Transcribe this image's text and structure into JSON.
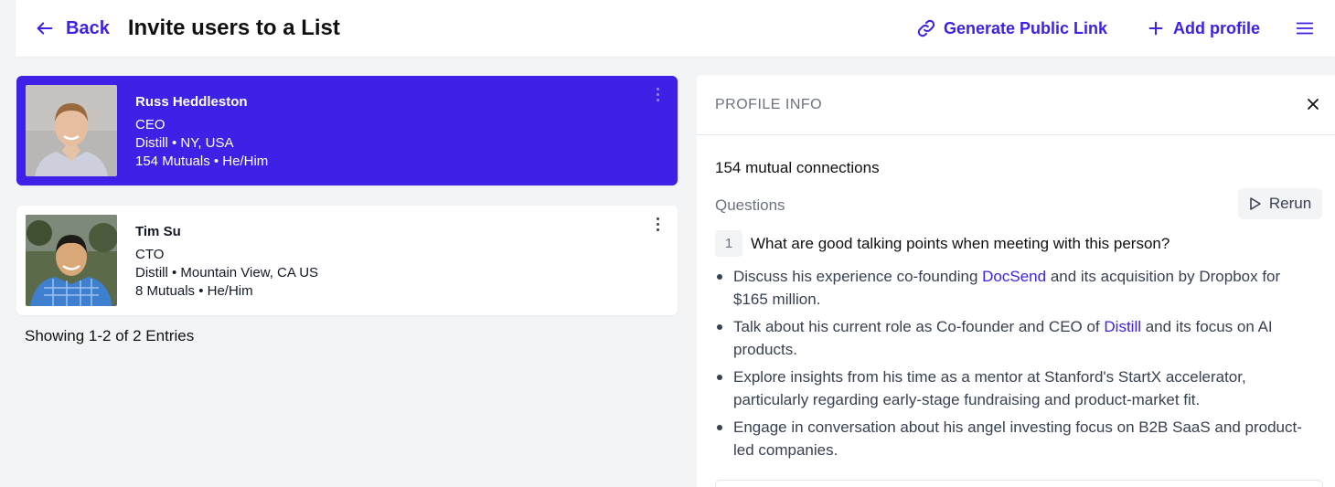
{
  "header": {
    "back_label": "Back",
    "title": "Invite users to a List",
    "generate_link_label": "Generate Public Link",
    "add_profile_label": "Add profile"
  },
  "profiles": [
    {
      "name": "Russ Heddleston",
      "role": "CEO",
      "location": "Distill • NY, USA",
      "meta": "154 Mutuals • He/Him",
      "selected": true
    },
    {
      "name": "Tim Su",
      "role": "CTO",
      "location": "Distill • Mountain View, CA US",
      "meta": "8 Mutuals • He/Him",
      "selected": false
    }
  ],
  "entries_text": "Showing 1-2 of 2 Entries",
  "panel": {
    "title": "PROFILE INFO",
    "mutual_text": "154 mutual connections",
    "questions_label": "Questions",
    "rerun_label": "Rerun",
    "question": {
      "number": "1",
      "text": "What are good talking points when meeting with this person?"
    },
    "answers": [
      {
        "pre": "Discuss his experience co-founding ",
        "link": "DocSend",
        "post": " and its acquisition by Dropbox for $165 million."
      },
      {
        "pre": "Talk about his current role as Co-founder and CEO of ",
        "link": "Distill",
        "post": " and its focus on AI products."
      },
      {
        "pre": "Explore insights from his time as a mentor at Stanford's StartX accelerator, particularly regarding early-stage fundraising and product-market fit.",
        "link": "",
        "post": ""
      },
      {
        "pre": "Engage in conversation about his angel investing focus on B2B SaaS and product-led companies.",
        "link": "",
        "post": ""
      }
    ]
  },
  "colors": {
    "accent": "#3d21e6",
    "background": "#f3f4f6"
  }
}
